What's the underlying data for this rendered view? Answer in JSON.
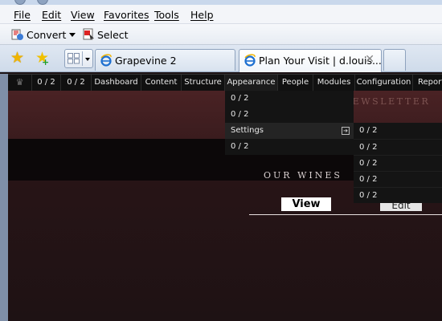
{
  "menubar": {
    "items": [
      "File",
      "Edit",
      "View",
      "Favorites",
      "Tools",
      "Help"
    ]
  },
  "toolbar": {
    "convert_label": "Convert",
    "select_label": "Select",
    "convert_icon": "pdf-convert-icon",
    "select_icon": "pdf-select-icon"
  },
  "tabs": [
    {
      "label": "Grapevine 2",
      "active": false
    },
    {
      "label": "Plan Your Visit | d.louis...",
      "active": true,
      "close": "✕"
    }
  ],
  "admin_menu": {
    "icon": "crown-icon",
    "items": [
      "0 / 2",
      "0 / 2",
      "Dashboard",
      "Content",
      "Structure",
      "Appearance",
      "People",
      "Modules",
      "Configuration",
      "Reports"
    ]
  },
  "dropdown_main": {
    "items": [
      "0 / 2",
      "0 / 2",
      "Settings",
      "0 / 2"
    ],
    "highlighted": "Settings"
  },
  "dropdown_sub": {
    "items": [
      "0 / 2",
      "0 / 2",
      "0 / 2",
      "0 / 2",
      "0 / 2"
    ]
  },
  "site": {
    "newsletter": "JOIN OUR NEWSLETTER",
    "our_wines": "OUR WINES",
    "view_label": "View",
    "edit_label": "Edit"
  },
  "colors": {
    "admin_bg": "#101010",
    "site_bg": "#2a1517",
    "dropdown_bg": "#141414"
  }
}
